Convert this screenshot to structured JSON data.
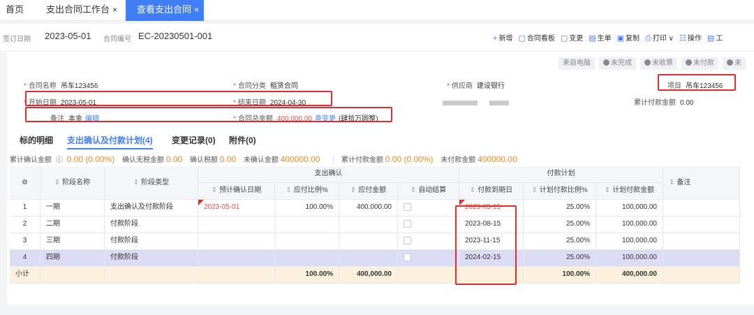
{
  "tabs": {
    "home": "首页",
    "workbench": "支出合同工作台",
    "view": "查看支出合同",
    "close_glyph": "×"
  },
  "header": {
    "sign_date_label": "签订日期",
    "sign_date": "2023-05-01",
    "contract_no_label": "合同编号",
    "contract_no": "EC-20230501-001"
  },
  "toolbar": [
    {
      "icon": "plus-icon",
      "glyph": "+",
      "label": "新增"
    },
    {
      "icon": "board-icon",
      "glyph": "▢",
      "label": "合同看板"
    },
    {
      "icon": "change-icon",
      "glyph": "▢",
      "label": "变更"
    },
    {
      "icon": "generate-icon",
      "glyph": "▤",
      "label": "生单"
    },
    {
      "icon": "copy-icon",
      "glyph": "▣",
      "label": "复制"
    },
    {
      "icon": "print-icon",
      "glyph": "⎙",
      "label": "打印 ∨"
    },
    {
      "icon": "operation-icon",
      "glyph": "☷",
      "label": "操作"
    },
    {
      "icon": "tool-icon",
      "glyph": "▤",
      "label": "工"
    }
  ],
  "statuses": [
    {
      "label": "来自电脑",
      "dot": false
    },
    {
      "label": "未完成",
      "dot": true
    },
    {
      "label": "未收票",
      "dot": true
    },
    {
      "label": "未付款",
      "dot": true
    },
    {
      "label": "未",
      "dot": true
    }
  ],
  "form": {
    "contract_name_label": "合同名称",
    "contract_name": "吊车123456",
    "category_label": "合同分类",
    "category": "租赁合同",
    "supplier_label": "供应商",
    "supplier": "建设银行",
    "project_label": "项目",
    "project": "吊车123456",
    "start_date_label": "开始日期",
    "start_date": "2023-05-01",
    "end_date_label": "结束日期",
    "end_date": "2024-04-30",
    "paid_total_label": "累计付款金额",
    "paid_total": "0.00",
    "remark_label": "备注",
    "remark_value": "本金",
    "remark_edit": "编辑",
    "total_label": "合同总金额",
    "total_value": "400,000.00",
    "view_change": "查变更",
    "total_caps": "(肆拾万圆整)"
  },
  "subtabs": [
    {
      "label": "标的明细",
      "active": false
    },
    {
      "label": "支出确认及付款计划(4)",
      "active": true
    },
    {
      "label": "变更记录(0)",
      "active": false
    },
    {
      "label": "附件(0)",
      "active": false
    }
  ],
  "summary": {
    "confirmed_label": "累计确认金额",
    "confirmed_value": "0.00 (0.00%)",
    "no_tax_label": "确认无税金额",
    "no_tax_value": "0.00",
    "tax_label": "确认税额",
    "tax_value": "0.00",
    "unconfirmed_label": "未确认金额",
    "unconfirmed_value": "400000.00",
    "paid_label": "累计付款金额",
    "paid_value": "0.00 (0.00%)",
    "unpaid_label": "未付款金额",
    "unpaid_value": "400000.00"
  },
  "table": {
    "settings_icon": "⚙",
    "group_confirm": "支出确认",
    "group_plan": "付款计划",
    "headers": {
      "stage_name": "阶段名称",
      "stage_type": "阶段类型",
      "expected_date": "预计确认日期",
      "payable_ratio": "应付比例%",
      "payable_amount": "应付金额",
      "auto_settle": "自动结算",
      "due_date": "付款到期日",
      "plan_ratio": "计划付款比例%",
      "plan_amount": "计划付款金额",
      "remark": "备注"
    },
    "rows": [
      {
        "no": "1",
        "stage_name": "一期",
        "stage_type": "支出确认及付款阶段",
        "expected_date": "2023-05-01",
        "payable_ratio": "100.00%",
        "payable_amount": "400,000.00",
        "due_date": "2023-05-15",
        "plan_ratio": "25.00%",
        "plan_amount": "100,000.00"
      },
      {
        "no": "2",
        "stage_name": "二期",
        "stage_type": "付款阶段",
        "expected_date": "",
        "payable_ratio": "",
        "payable_amount": "",
        "due_date": "2023-08-15",
        "plan_ratio": "25.00%",
        "plan_amount": "100,000.00"
      },
      {
        "no": "3",
        "stage_name": "三期",
        "stage_type": "付款阶段",
        "expected_date": "",
        "payable_ratio": "",
        "payable_amount": "",
        "due_date": "2023-11-15",
        "plan_ratio": "25.00%",
        "plan_amount": "100,000.00"
      },
      {
        "no": "4",
        "stage_name": "四期",
        "stage_type": "付款阶段",
        "expected_date": "",
        "payable_ratio": "",
        "payable_amount": "",
        "due_date": "2024-02-15",
        "plan_ratio": "25.00%",
        "plan_amount": "100,000.00"
      }
    ],
    "total": {
      "label": "小计",
      "payable_ratio": "100.00%",
      "payable_amount": "400,000.00",
      "plan_ratio": "100.00%",
      "plan_amount": "400,000.00"
    },
    "selected_row": 4
  },
  "colors": {
    "accent": "#3f7ef7",
    "highlight_box": "#e32b2b",
    "amount_orange": "#f08a24",
    "selected_row": "#dddcf5",
    "total_row": "#fbf1dc"
  }
}
